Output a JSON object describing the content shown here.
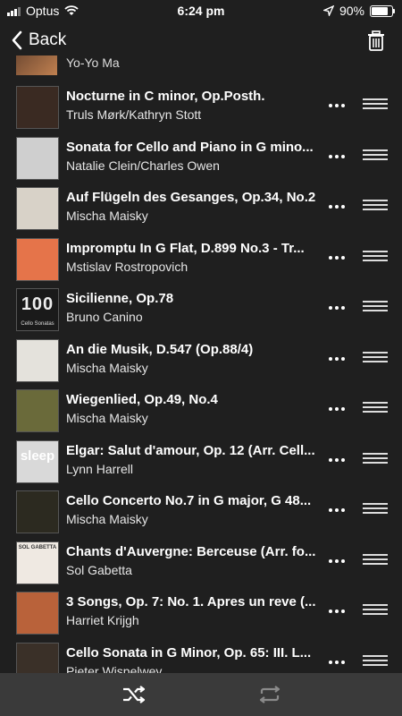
{
  "status_bar": {
    "carrier": "Optus",
    "time": "6:24 pm",
    "battery": "90%",
    "battery_level": 0.9,
    "icons": [
      "signal-icon",
      "wifi-icon",
      "location-arrow-icon",
      "battery-icon"
    ]
  },
  "nav": {
    "back_label": "Back",
    "back_icon": "chevron-left-icon",
    "trash_icon": "trash-icon"
  },
  "partial_track": {
    "title": "Yo-Yo Ma"
  },
  "tracks": [
    {
      "title": "Nocturne in C minor, Op.Posth.",
      "artist": "Truls Mørk/Kathryn Stott",
      "art_color": "#3a2a22"
    },
    {
      "title": "Sonata for Cello and Piano in G mino...",
      "artist": "Natalie Clein/Charles Owen",
      "art_color": "#cfcfcf"
    },
    {
      "title": "Auf Flügeln des Gesanges, Op.34, No.2",
      "artist": "Mischa Maisky",
      "art_color": "#d8d2c8"
    },
    {
      "title": "Impromptu In G Flat, D.899 No.3 - Tr...",
      "artist": "Mstislav Rostropovich",
      "art_color": "#e5744a"
    },
    {
      "title": "Sicilienne, Op.78",
      "artist": "Bruno Canino",
      "art_color": "#1a1a1a",
      "art_text": "100",
      "art_subtext": "Cello Sonatas"
    },
    {
      "title": "An die Musik, D.547 (Op.88/4)",
      "artist": "Mischa Maisky",
      "art_color": "#e4e2dc"
    },
    {
      "title": "Wiegenlied, Op.49, No.4",
      "artist": "Mischa Maisky",
      "art_color": "#6a6a3a"
    },
    {
      "title": "Elgar: Salut d'amour, Op. 12 (Arr. Cell...",
      "artist": "Lynn Harrell",
      "art_color": "#d9d9d9",
      "art_text": "sleep"
    },
    {
      "title": "Cello Concerto No.7 in G major, G 48...",
      "artist": "Mischa Maisky",
      "art_color": "#2c2a20"
    },
    {
      "title": "Chants d'Auvergne: Berceuse (Arr. fo...",
      "artist": "Sol Gabetta",
      "art_color": "#efe9e2",
      "art_text": "SOL GABETTA"
    },
    {
      "title": "3 Songs, Op. 7: No. 1. Apres un reve (...",
      "artist": "Harriet Krijgh",
      "art_color": "#b9623a"
    },
    {
      "title": "Cello Sonata in G Minor, Op. 65: III. L...",
      "artist": "Pieter Wispelwey",
      "art_color": "#3a3028"
    }
  ],
  "bottom_bar": {
    "shuffle_icon": "shuffle-icon",
    "repeat_icon": "repeat-icon"
  }
}
